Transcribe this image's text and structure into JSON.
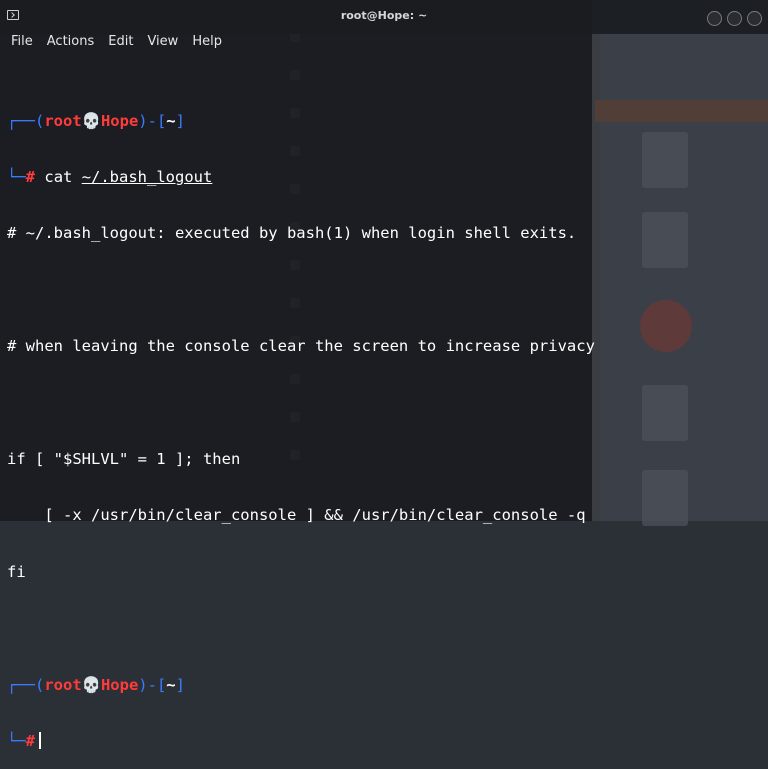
{
  "window": {
    "title": "root@Hope: ~"
  },
  "menu": {
    "items": [
      "File",
      "Actions",
      "Edit",
      "View",
      "Help"
    ]
  },
  "prompt": {
    "user": "root",
    "skull": "💀",
    "host": "Hope",
    "dir": "~",
    "symbol": "#"
  },
  "session": {
    "command": "cat ~/.bash_logout",
    "output": [
      "# ~/.bash_logout: executed by bash(1) when login shell exits.",
      "",
      "# when leaving the console clear the screen to increase privacy",
      "",
      "if [ \"$SHLVL\" = 1 ]; then",
      "    [ -x /usr/bin/clear_console ] && /usr/bin/clear_console -q",
      "fi"
    ]
  },
  "colors": {
    "prompt_frame": "#3a7cff",
    "prompt_user_host": "#ff3b3b",
    "text": "#ffffff",
    "terminal_bg": "#16181e"
  }
}
